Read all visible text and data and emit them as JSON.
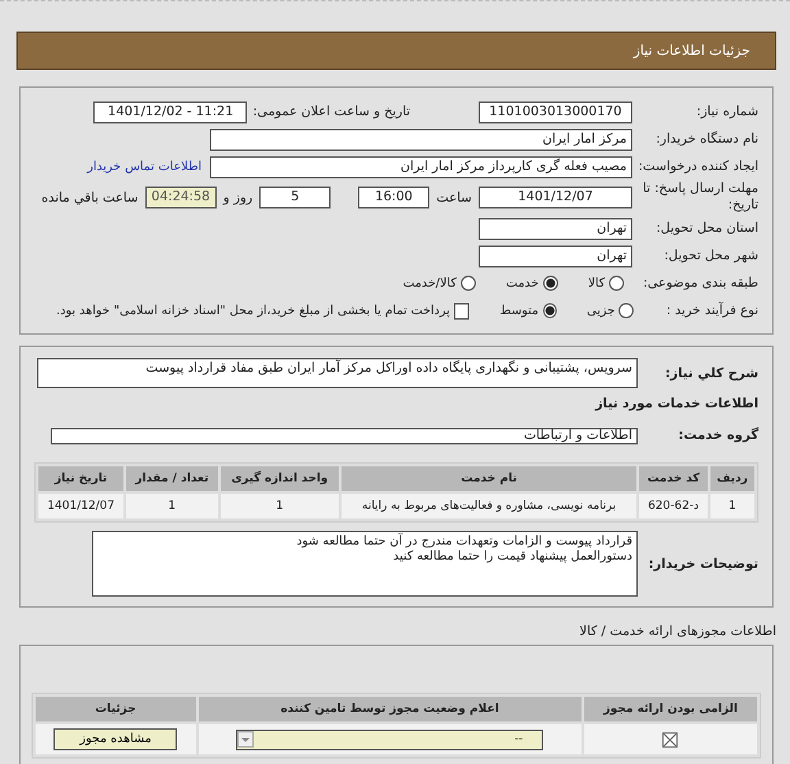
{
  "header": {
    "title": "جزئیات اطلاعات نیاز"
  },
  "need_number": {
    "label": "شماره نیاز:",
    "value": "1101003013000170"
  },
  "announce": {
    "label": "تاریخ و ساعت اعلان عمومی:",
    "value": "1401/12/02 - 11:21"
  },
  "buyer": {
    "label": "نام دستگاه خریدار:",
    "value": "مرکز امار ایران"
  },
  "creator": {
    "label": "ایجاد کننده درخواست:",
    "value": "مصیب فعله گری کارپرداز مرکز امار ایران",
    "contact_link": "اطلاعات تماس خریدار"
  },
  "deadline": {
    "label": "مهلت ارسال پاسخ: تا تاریخ:",
    "date": "1401/12/07",
    "time_label": "ساعت",
    "time": "16:00",
    "days": "5",
    "days_label": "روز و",
    "remaining": "04:24:58",
    "remaining_label": "ساعت باقي مانده"
  },
  "province": {
    "label": "استان محل تحویل:",
    "value": "تهران"
  },
  "city": {
    "label": "شهر محل تحویل:",
    "value": "تهران"
  },
  "category": {
    "label": "طبقه بندی موضوعی:",
    "options": [
      {
        "label": "کالا",
        "selected": false
      },
      {
        "label": "خدمت",
        "selected": true
      },
      {
        "label": "کالا/خدمت",
        "selected": false
      }
    ]
  },
  "process": {
    "label": "نوع فرآیند خرید :",
    "options": [
      {
        "label": "جزیی",
        "selected": false
      },
      {
        "label": "متوسط",
        "selected": true
      }
    ],
    "treasury": {
      "label": "پرداخت تمام یا بخشی از مبلغ خرید،از محل \"اسناد خزانه اسلامی\" خواهد بود.",
      "checked": false
    }
  },
  "description": {
    "label": "شرح کلي نیاز:",
    "value": "سرویس، پشتیبانی و نگهداری پایگاه داده اوراکل مرکز آمار ایران  طبق مفاد قرارداد پیوست"
  },
  "services_heading": "اطلاعات خدمات مورد نیاز",
  "service_group": {
    "label": "گروه خدمت:",
    "value": "اطلاعات و ارتباطات"
  },
  "services_table": {
    "columns": [
      "ردیف",
      "کد خدمت",
      "نام خدمت",
      "واحد اندازه گیری",
      "تعداد / مقدار",
      "تاریخ نیاز"
    ],
    "rows": [
      [
        "1",
        "د-62-620",
        "برنامه نویسی، مشاوره و فعالیت‌های مربوط به رایانه",
        "1",
        "1",
        "1401/12/07"
      ]
    ]
  },
  "buyer_notes": {
    "label": "توضیحات خریدار:",
    "lines": [
      "قرارداد پیوست و الزامات وتعهدات مندرج در آن حتما مطالعه شود",
      "دستورالعمل پیشنهاد قیمت را حتما مطالعه کنید"
    ]
  },
  "permits_heading": "اطلاعات مجوزهای ارائه خدمت / کالا",
  "permits_table": {
    "columns": [
      "الزامی بودن ارائه مجوز",
      "اعلام وضعیت مجوز توسط تامین کننده",
      "جزئیات"
    ],
    "rows": [
      {
        "required": true,
        "status": "--",
        "details_button": "مشاهده مجوز"
      }
    ]
  }
}
